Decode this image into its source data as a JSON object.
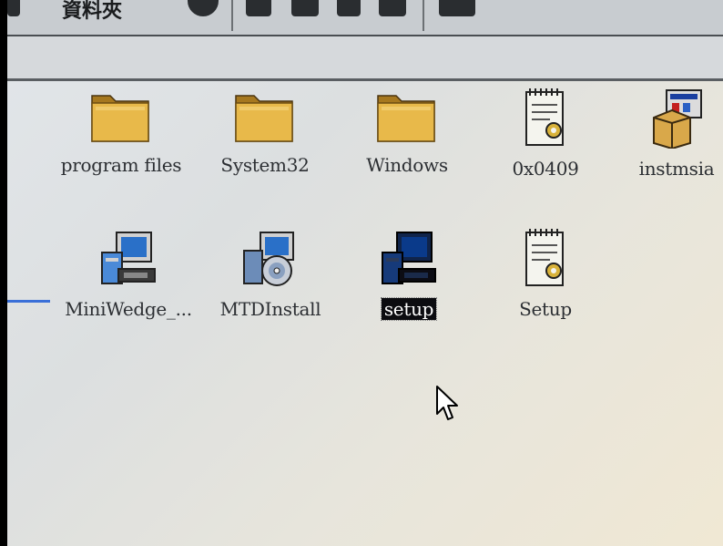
{
  "toolbar": {
    "title_fragment": "資料夾"
  },
  "items": [
    {
      "label": "program files",
      "icon": "folder-icon"
    },
    {
      "label": "System32",
      "icon": "folder-icon"
    },
    {
      "label": "Windows",
      "icon": "folder-icon"
    },
    {
      "label": "0x0409",
      "icon": "settings-document-icon"
    },
    {
      "label": "instmsia",
      "icon": "installer-package-icon"
    },
    {
      "label": "MiniWedge_...",
      "icon": "setup-computer-icon"
    },
    {
      "label": "MTDInstall",
      "icon": "setup-cd-icon"
    },
    {
      "label": "setup",
      "icon": "setup-computer-icon",
      "selected": true
    },
    {
      "label": "Setup",
      "icon": "settings-document-icon"
    }
  ],
  "colors": {
    "folder": "#e8b94a",
    "selection": "#0c0c10",
    "selection_mark": "#3a6fd8"
  }
}
